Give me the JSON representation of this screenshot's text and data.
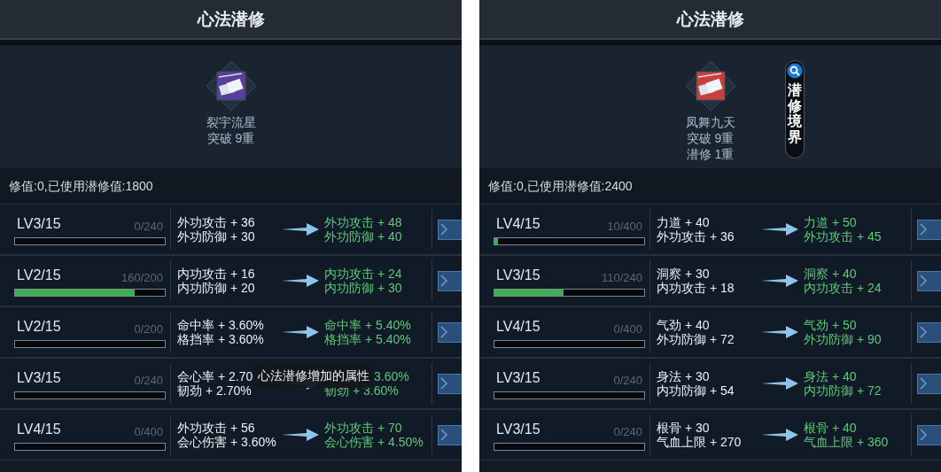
{
  "panels": [
    {
      "title": "心法潜修",
      "skill": {
        "color": "#5a3f9a",
        "lines": [
          "裂宇流星",
          "突破 9重"
        ]
      },
      "info": "修值:0,已使用潜修值:1800",
      "rows": [
        {
          "lv": "LV3/15",
          "count": "0/240",
          "level": 0,
          "current": [
            "外功攻击 + 36",
            "外功防御 + 30"
          ],
          "next": [
            "外功攻击 + 48",
            "外功防御 + 40"
          ]
        },
        {
          "lv": "LV2/15",
          "count": "160/200",
          "level": 0.8,
          "current": [
            "内功攻击 + 16",
            "内功防御 + 20"
          ],
          "next": [
            "内功攻击 + 24",
            "内功防御 + 30"
          ]
        },
        {
          "lv": "LV2/15",
          "count": "0/200",
          "level": 0,
          "current": [
            "命中率 + 3.60%",
            "格挡率 + 3.60%"
          ],
          "next": [
            "命中率 + 5.40%",
            "格挡率 + 5.40%"
          ]
        },
        {
          "lv": "LV3/15",
          "count": "0/240",
          "level": 0,
          "current": [
            "会心率 + 2.70",
            "韧劲 + 2.70%"
          ],
          "next": [
            "3.60%",
            "韧劲 + 3.60%"
          ]
        },
        {
          "lv": "LV4/15",
          "count": "0/400",
          "level": 0,
          "current": [
            "外功攻击 + 56",
            "会心伤害 + 3.60%"
          ],
          "next": [
            "外功攻击 + 70",
            "会心伤害 + 4.50%"
          ]
        }
      ],
      "tooltip": "心法潜修增加的属性"
    },
    {
      "title": "心法潜修",
      "skill": {
        "color": "#c8403c",
        "lines": [
          "凤舞九天",
          "突破 9重",
          "潜修 1重"
        ]
      },
      "realm_button": "潜修境界",
      "info": "修值:0,已使用潜修值:2400",
      "rows": [
        {
          "lv": "LV4/15",
          "count": "10/400",
          "level": 0.025,
          "current": [
            "力道 + 40",
            "外功攻击 + 36"
          ],
          "next": [
            "力道 + 50",
            "外功攻击 + 45"
          ]
        },
        {
          "lv": "LV3/15",
          "count": "110/240",
          "level": 0.46,
          "current": [
            "洞察 + 30",
            "内功攻击 + 18"
          ],
          "next": [
            "洞察 + 40",
            "内功攻击 + 24"
          ]
        },
        {
          "lv": "LV4/15",
          "count": "0/400",
          "level": 0,
          "current": [
            "气劲 + 40",
            "外功防御 + 72"
          ],
          "next": [
            "气劲 + 50",
            "外功防御 + 90"
          ]
        },
        {
          "lv": "LV3/15",
          "count": "0/240",
          "level": 0,
          "current": [
            "身法 + 30",
            "内功防御 + 54"
          ],
          "next": [
            "身法 + 40",
            "内功防御 + 72"
          ]
        },
        {
          "lv": "LV3/15",
          "count": "0/240",
          "level": 0,
          "current": [
            "根骨 + 30",
            "气血上限 + 270"
          ],
          "next": [
            "根骨 + 40",
            "气血上限 + 360"
          ]
        }
      ]
    }
  ]
}
